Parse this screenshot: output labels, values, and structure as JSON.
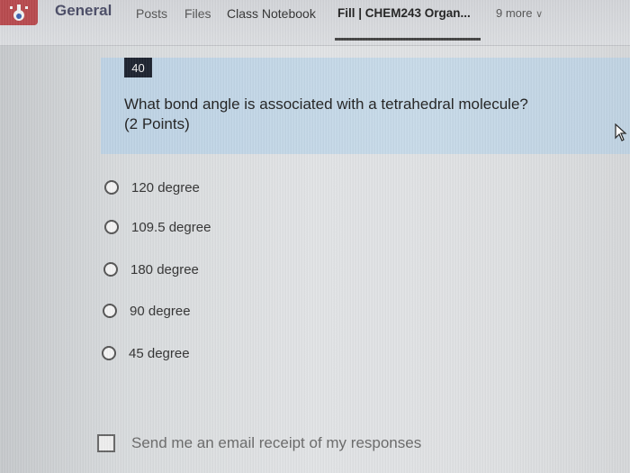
{
  "header": {
    "team_title": "General",
    "tabs": [
      "Posts",
      "Files",
      "Class Notebook",
      "Fill | CHEM243 Organ...",
      "9 more"
    ],
    "active_tab_index": 3
  },
  "question": {
    "number": "40",
    "text_line1": "What bond angle is associated with a tetrahedral molecule?",
    "text_line2": "(2 Points)"
  },
  "options": [
    "120 degree",
    "109.5 degree",
    "180 degree",
    "90 degree",
    "45 degree"
  ],
  "email_receipt": {
    "label": "Send me an email receipt of my responses",
    "checked": false
  },
  "colors": {
    "question_band": "#c8dbe9",
    "question_number_badge": "#1d2330",
    "team_icon": "#b84a4e"
  }
}
